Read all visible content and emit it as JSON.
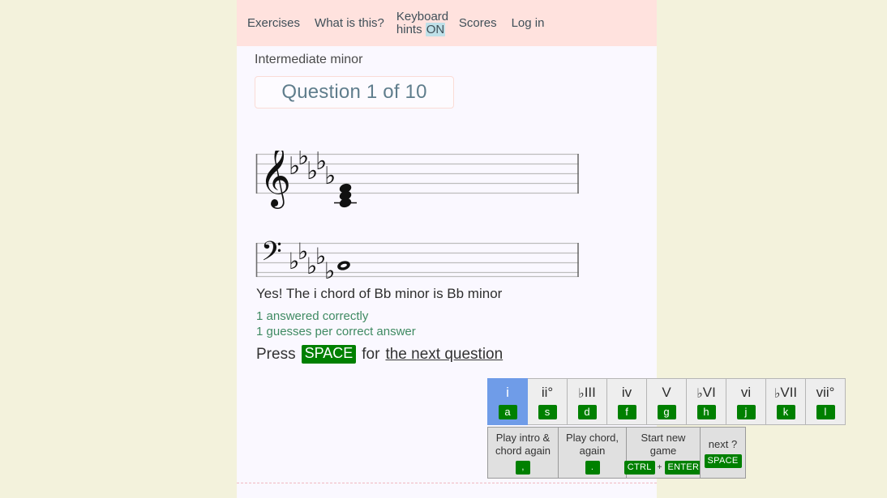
{
  "nav": {
    "items": [
      {
        "label": "Exercises",
        "name": "nav-exercises"
      },
      {
        "label": "What is this?",
        "name": "nav-what-is-this"
      },
      {
        "label": "Scores",
        "name": "nav-scores"
      },
      {
        "label": "Log in",
        "name": "nav-log-in"
      }
    ],
    "keyboard_hints": {
      "label": "Keyboard hints",
      "state": "ON"
    }
  },
  "exercise": {
    "title": "Intermediate minor",
    "question_counter": "Question 1 of 10"
  },
  "notation": {
    "treble": {
      "clef": "treble-clef",
      "key_signature": "5 flats",
      "flat_count": 5,
      "chord": "triad"
    },
    "bass": {
      "clef": "bass-clef",
      "key_signature": "5 flats",
      "flat_count": 5,
      "note": "whole-note"
    }
  },
  "feedback": {
    "result": "Yes! The i chord of Bb minor is Bb minor",
    "answered_correctly": "1 answered correctly",
    "guesses_per_answer": "1 guesses per correct answer",
    "press_prefix": "Press",
    "press_key": "SPACE",
    "press_middle": "for",
    "press_link": "the next question"
  },
  "chords": [
    {
      "label": "i",
      "flat": "",
      "key": "a",
      "selected": true
    },
    {
      "label": "ii°",
      "flat": "",
      "key": "s",
      "selected": false
    },
    {
      "label": "III",
      "flat": "♭",
      "key": "d",
      "selected": false
    },
    {
      "label": "iv",
      "flat": "",
      "key": "f",
      "selected": false
    },
    {
      "label": "V",
      "flat": "",
      "key": "g",
      "selected": false
    },
    {
      "label": "VI",
      "flat": "♭",
      "key": "h",
      "selected": false
    },
    {
      "label": "vi",
      "flat": "",
      "key": "j",
      "selected": false
    },
    {
      "label": "VII",
      "flat": "♭",
      "key": "k",
      "selected": false
    },
    {
      "label": "vii°",
      "flat": "",
      "key": "l",
      "selected": false
    }
  ],
  "actions": {
    "play_intro": {
      "label": "Play intro & chord again",
      "key": ","
    },
    "play_chord": {
      "label": "Play chord, again",
      "key": "."
    },
    "start_new": {
      "label": "Start new game",
      "key1": "CTRL",
      "plus": "+",
      "key2": "ENTER"
    },
    "next": {
      "label": "next ?",
      "key": "SPACE"
    }
  },
  "colors": {
    "page_background": "#f3f2dc",
    "panel_background": "#faf8ff",
    "navbar_background": "#ffe2de",
    "accent_green": "#008000",
    "selected_blue": "#6f9ce8",
    "stat_green": "#3f8a62",
    "hint_highlight": "#bfe0e8"
  }
}
